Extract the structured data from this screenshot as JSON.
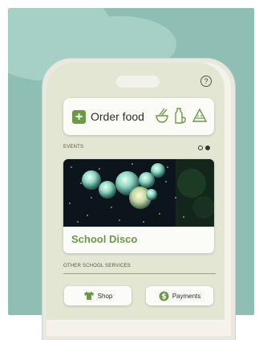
{
  "header": {
    "help_icon_glyph": "?"
  },
  "order": {
    "label": "Order food",
    "plus_glyph": "+",
    "icons": [
      "bowl-icon",
      "drink-icon",
      "watermelon-icon"
    ]
  },
  "events": {
    "section_label": "EVENTS",
    "carousel_dots": 2,
    "active_dot": 2,
    "items": [
      {
        "title": "School Disco",
        "image": "disco-ball-photo"
      }
    ]
  },
  "services": {
    "section_label": "OTHER SCHOOL SERVICES",
    "shop_label": "Shop",
    "payments_label": "Payments"
  },
  "colors": {
    "accent": "#6b9b45",
    "background": "#8fbfb4",
    "screen": "#e4e6d4"
  }
}
